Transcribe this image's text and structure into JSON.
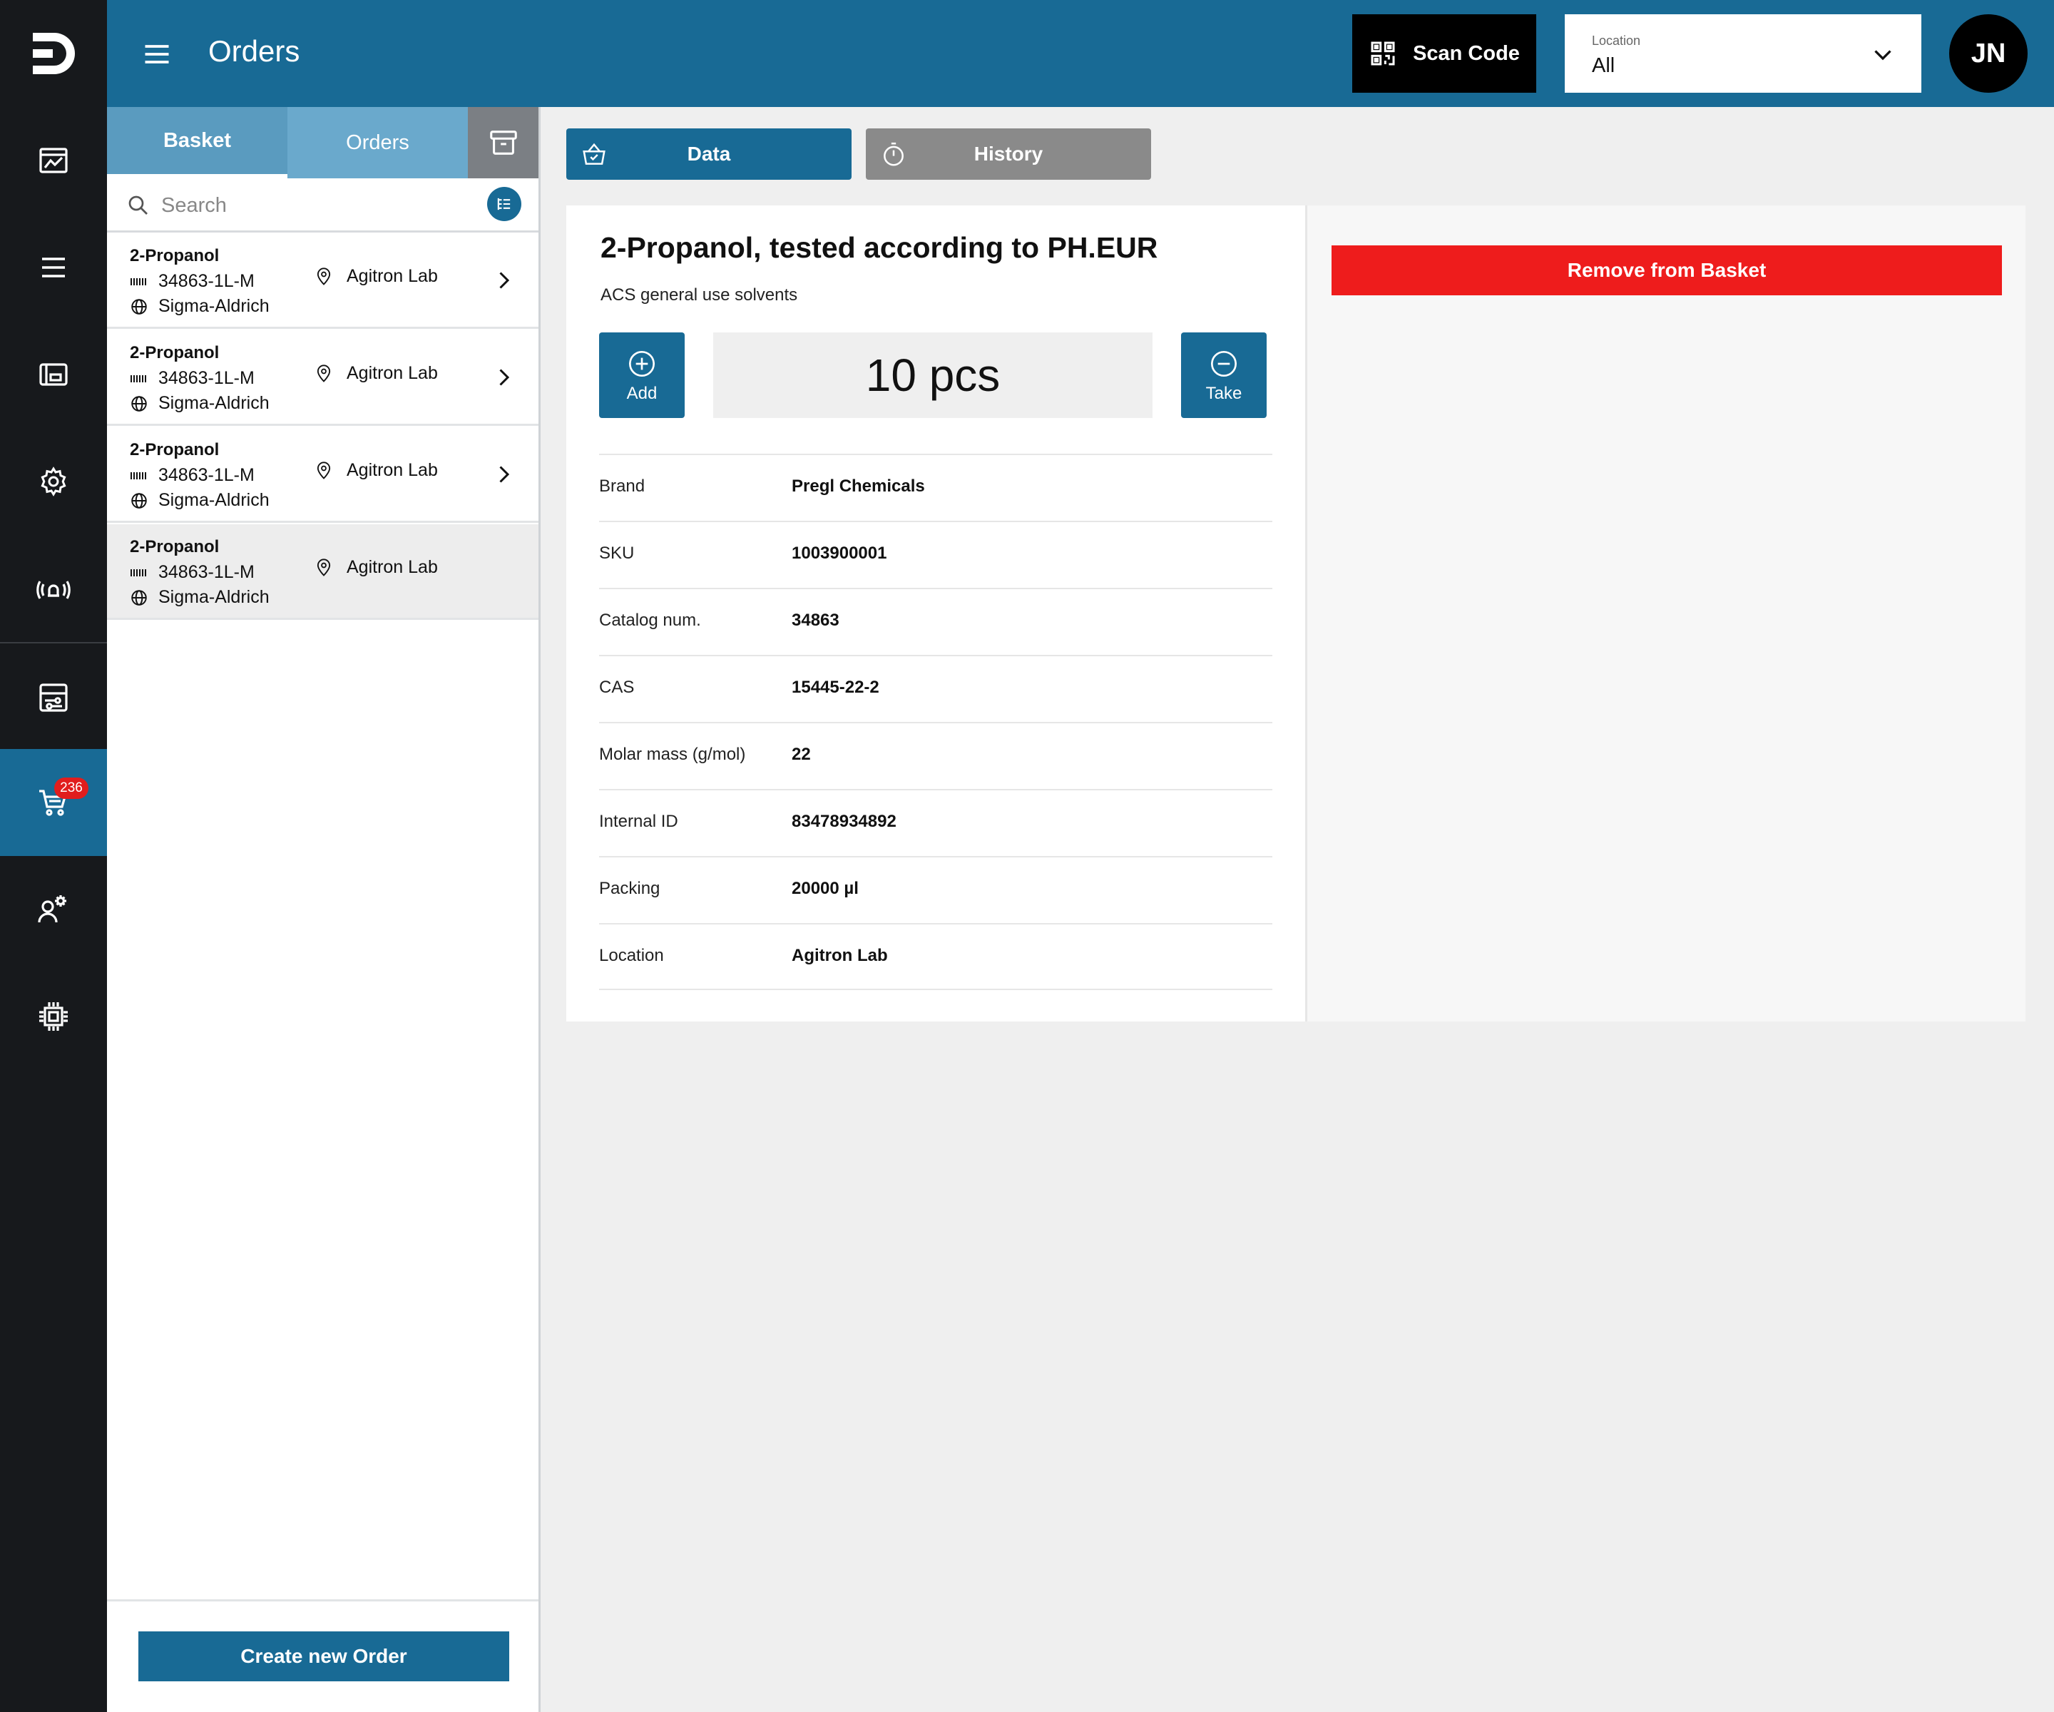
{
  "colors": {
    "primary": "#186a95",
    "rail": "#17191c",
    "danger": "#ee1c1c",
    "badge": "#e11d1d"
  },
  "rail": {
    "items": [
      {
        "icon": "chart-icon"
      },
      {
        "icon": "list-icon"
      },
      {
        "icon": "storage-icon"
      },
      {
        "icon": "settings-icon"
      },
      {
        "icon": "alarm-icon"
      },
      {
        "icon": "sliders-icon"
      },
      {
        "icon": "cart-icon",
        "active": true,
        "badge": "236"
      },
      {
        "icon": "user-settings-icon"
      },
      {
        "icon": "chip-icon"
      }
    ]
  },
  "header": {
    "title": "Orders",
    "scan_label": "Scan Code",
    "location_label": "Location",
    "location_value": "All",
    "avatar_initials": "JN"
  },
  "left_panel": {
    "tabs": {
      "basket": "Basket",
      "orders": "Orders"
    },
    "search_placeholder": "Search",
    "items": [
      {
        "name": "2-Propanol",
        "code": "34863-1L-M",
        "brand": "Sigma-Aldrich",
        "location": "Agitron Lab"
      },
      {
        "name": "2-Propanol",
        "code": "34863-1L-M",
        "brand": "Sigma-Aldrich",
        "location": "Agitron Lab"
      },
      {
        "name": "2-Propanol",
        "code": "34863-1L-M",
        "brand": "Sigma-Aldrich",
        "location": "Agitron Lab"
      },
      {
        "name": "2-Propanol",
        "code": "34863-1L-M",
        "brand": "Sigma-Aldrich",
        "location": "Agitron Lab"
      }
    ],
    "create_label": "Create new Order"
  },
  "main": {
    "tabs": {
      "data": "Data",
      "history": "History"
    },
    "product": {
      "title": "2-Propanol, tested according to PH.EUR",
      "subtitle": "ACS general use solvents",
      "quantity": "10 pcs",
      "add_label": "Add",
      "take_label": "Take",
      "properties": [
        {
          "key": "Brand",
          "value": "Pregl Chemicals"
        },
        {
          "key": "SKU",
          "value": "1003900001"
        },
        {
          "key": "Catalog num.",
          "value": "34863"
        },
        {
          "key": "CAS",
          "value": "15445-22-2"
        },
        {
          "key": "Molar mass (g/mol)",
          "value": "22"
        },
        {
          "key": "Internal ID",
          "value": "83478934892"
        },
        {
          "key": "Packing",
          "value": "20000 µl"
        },
        {
          "key": "Location",
          "value": "Agitron Lab"
        }
      ]
    },
    "remove_label": "Remove from Basket"
  }
}
